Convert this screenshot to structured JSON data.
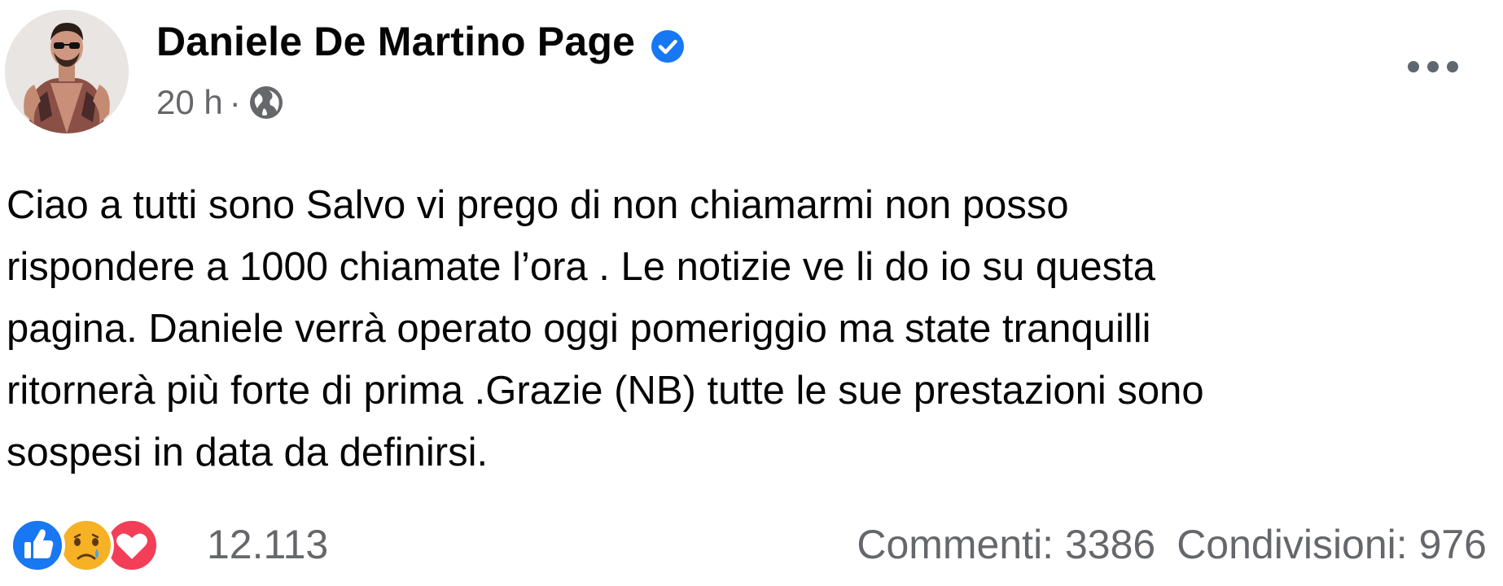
{
  "post": {
    "page_name": "Daniele De Martino Page",
    "verified_icon": "verified-badge-icon",
    "time": "20 h",
    "separator": "·",
    "audience_icon": "globe-icon",
    "more_icon": "more-options-icon",
    "text": "Ciao a tutti sono Salvo vi prego di non chiamarmi non posso\nrispondere a 1000 chiamate l’ora . Le notizie ve li do io su questa\npagina. Daniele verrà operato oggi pomeriggio ma state tranquilli\nritornerà più forte di prima .Grazie (NB) tutte le sue prestazioni sono\nsospesi in data da definirsi."
  },
  "footer": {
    "reaction_icons": [
      "like-icon",
      "sad-icon",
      "love-icon"
    ],
    "reaction_count": "12.113",
    "comments": "Commenti: 3386",
    "shares": "Condivisioni: 976"
  },
  "colors": {
    "accent_blue": "#1877f2",
    "secondary_text": "#65676b",
    "love_red": "#f33e58",
    "sad_yellow": "#f7b125"
  }
}
